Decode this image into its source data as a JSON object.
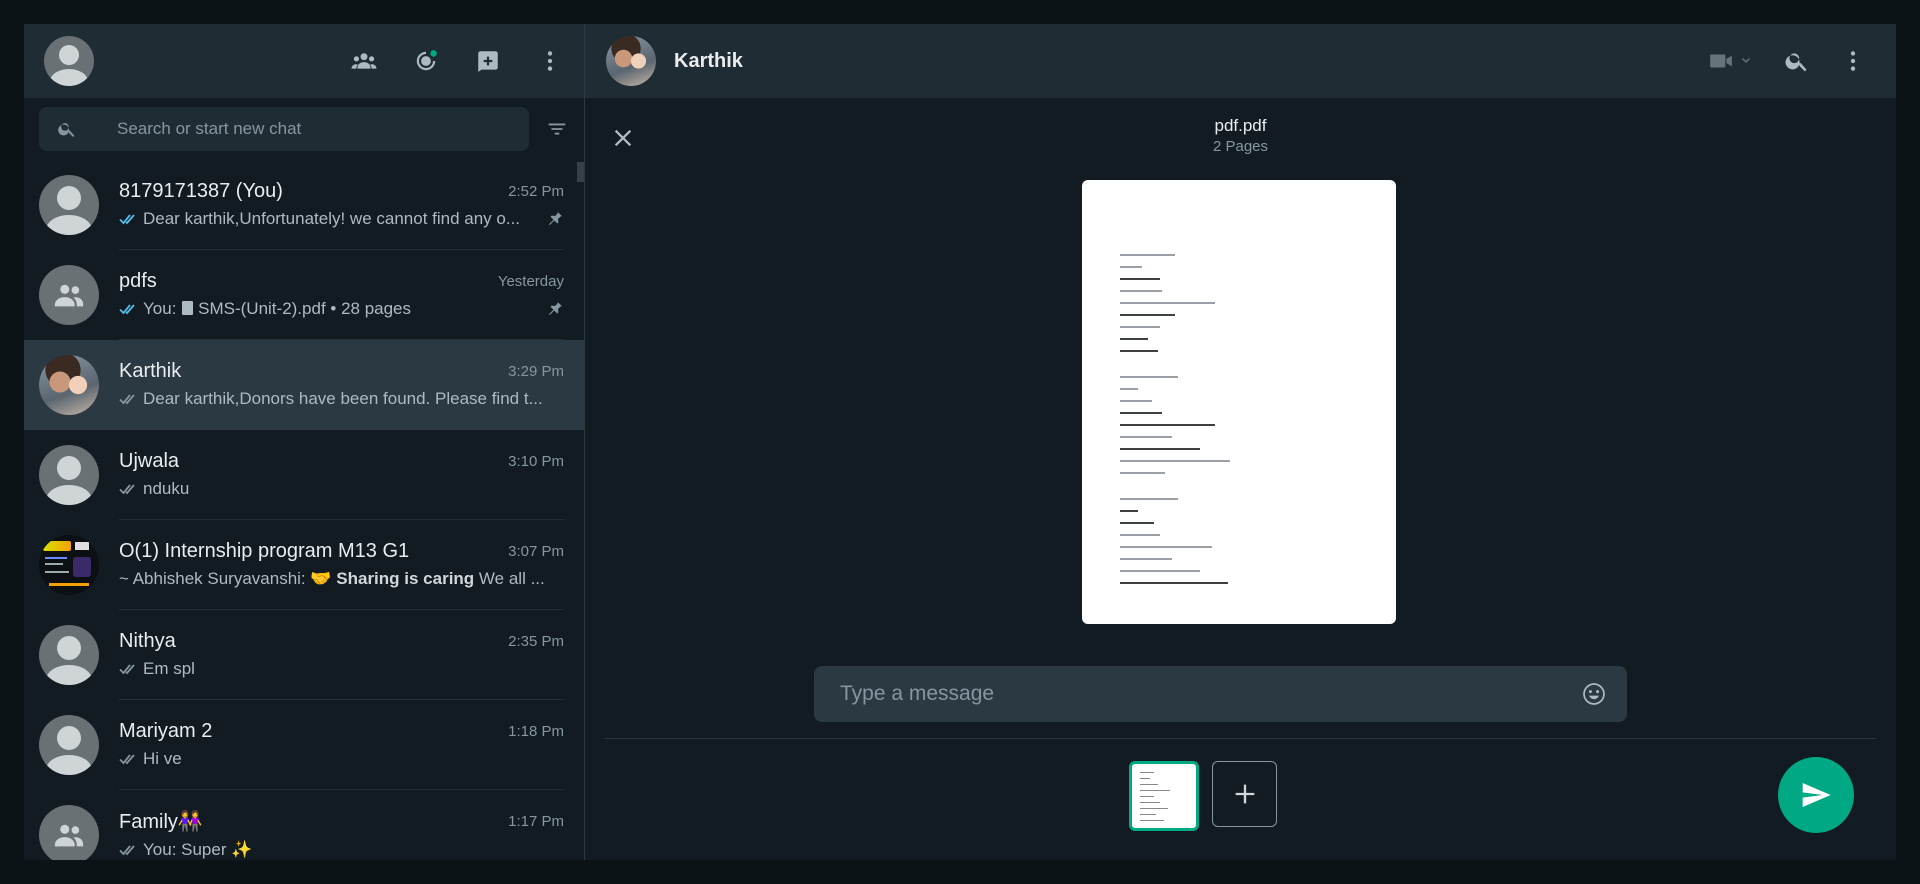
{
  "left_header": {
    "icons": [
      "communities-icon",
      "status-icon",
      "new-chat-icon",
      "menu-icon"
    ]
  },
  "search": {
    "placeholder": "Search or start new chat"
  },
  "chats": [
    {
      "name": "8179171387 (You)",
      "time": "2:52 Pm",
      "preview": "Dear karthik,Unfortunately! we cannot find any o...",
      "ticks": "read",
      "pinned": true
    },
    {
      "name": "pdfs",
      "time": "Yesterday",
      "preview_prefix": "You: ",
      "preview": "SMS-(Unit-2).pdf • 28 pages",
      "ticks": "read",
      "pinned": true
    },
    {
      "name": "Karthik",
      "time": "3:29 Pm",
      "preview": "Dear karthik,Donors have been found. Please find t...",
      "ticks": "delivered",
      "active": true
    },
    {
      "name": "Ujwala",
      "time": "3:10 Pm",
      "preview": "nduku",
      "ticks": "delivered"
    },
    {
      "name": "O(1) Internship program M13 G1",
      "time": "3:07 Pm",
      "preview_prefix": "~ Abhishek Suryavanshi: 🤝 ",
      "preview_bold": "Sharing is caring",
      "preview": " We all ..."
    },
    {
      "name": "Nithya",
      "time": "2:35 Pm",
      "preview": "Em spl",
      "ticks": "delivered"
    },
    {
      "name": "Mariyam 2",
      "time": "1:18 Pm",
      "preview": "Hi ve",
      "ticks": "delivered"
    },
    {
      "name": "Family👭",
      "time": "1:17 Pm",
      "preview": "You: Super ✨",
      "ticks": "delivered"
    }
  ],
  "conversation": {
    "contact_name": "Karthik"
  },
  "file_preview": {
    "file_name": "pdf.pdf",
    "page_count": "2 Pages"
  },
  "composer": {
    "placeholder": "Type a message"
  },
  "colors": {
    "accent": "#00a884",
    "panel": "#202c33",
    "background": "#111b21",
    "read_tick": "#53bdeb"
  }
}
